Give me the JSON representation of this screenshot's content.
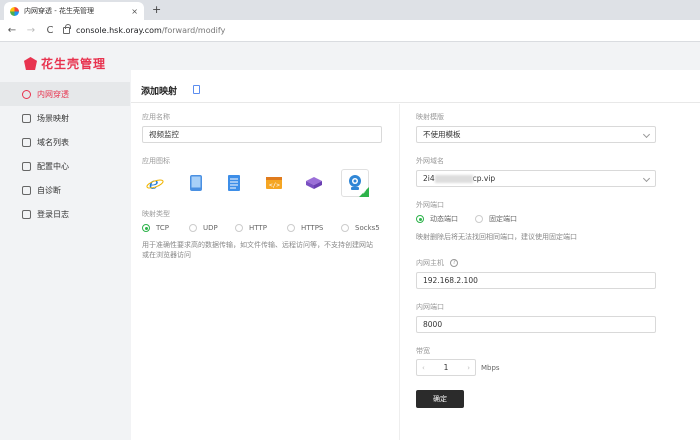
{
  "browser": {
    "tab_title": "内网穿透 - 花生壳管理",
    "tab_close": "×",
    "new_tab": "+",
    "back": "←",
    "forward": "→",
    "reload": "C",
    "url_host": "console.hsk.oray.com",
    "url_path": "/forward/modify"
  },
  "sidebar": {
    "logo_text": "花生壳管理",
    "items": [
      {
        "label": "内网穿透",
        "active": true
      },
      {
        "label": "场景映射"
      },
      {
        "label": "域名列表"
      },
      {
        "label": "配置中心"
      },
      {
        "label": "自诊断"
      },
      {
        "label": "登录日志"
      }
    ]
  },
  "main": {
    "title": "添加映射",
    "left": {
      "app_name_label": "应用名称",
      "app_name_value": "视频监控",
      "app_icon_label": "应用图标",
      "map_type_label": "映射类型",
      "map_types": [
        "TCP",
        "UDP",
        "HTTP",
        "HTTPS",
        "Socks5"
      ],
      "map_type_selected": "TCP",
      "help_line1": "用于准确性要求高的数据传输，如文件传输、远程访问等，不支持创建网站",
      "help_line2": "或在浏览器访问"
    },
    "right": {
      "template_label": "映射模版",
      "template_value": "不使用模板",
      "domain_label": "外网域名",
      "domain_value_prefix": "2i4",
      "domain_value_suffix": "cp.vip",
      "port_label": "外网端口",
      "port_options": [
        "动态端口",
        "固定端口"
      ],
      "port_help": "映射删除后将无法找回相同端口，建议使用固定端口",
      "host_label": "内网主机",
      "host_info": "?",
      "host_value": "192.168.2.100",
      "inner_port_label": "内网端口",
      "inner_port_value": "8000",
      "bandwidth_label": "带宽",
      "bandwidth_value": "1",
      "bandwidth_unit": "Mbps",
      "step_minus": "‹",
      "step_plus": "›",
      "confirm_label": "确定"
    }
  }
}
